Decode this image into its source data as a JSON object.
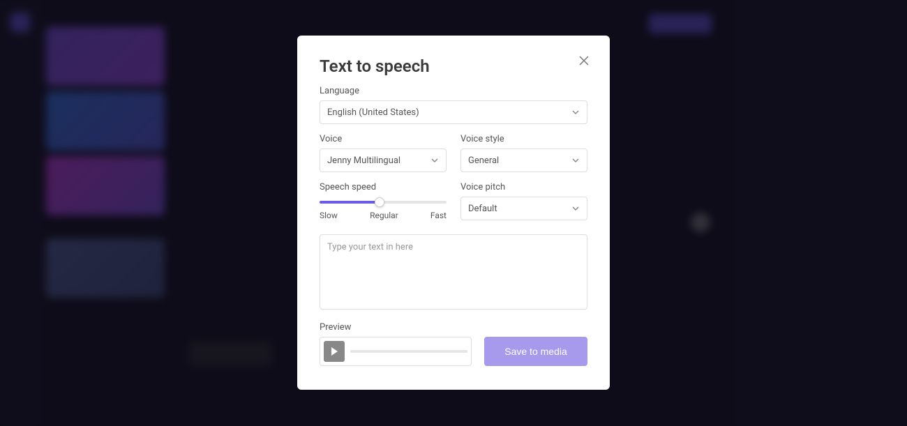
{
  "modal": {
    "title": "Text to speech",
    "language": {
      "label": "Language",
      "value": "English (United States)"
    },
    "voice": {
      "label": "Voice",
      "value": "Jenny Multilingual"
    },
    "voice_style": {
      "label": "Voice style",
      "value": "General"
    },
    "speech_speed": {
      "label": "Speech speed",
      "marks": {
        "slow": "Slow",
        "regular": "Regular",
        "fast": "Fast"
      }
    },
    "voice_pitch": {
      "label": "Voice pitch",
      "value": "Default"
    },
    "text_input": {
      "placeholder": "Type your text in here"
    },
    "preview": {
      "label": "Preview"
    },
    "save_button": "Save to media"
  }
}
